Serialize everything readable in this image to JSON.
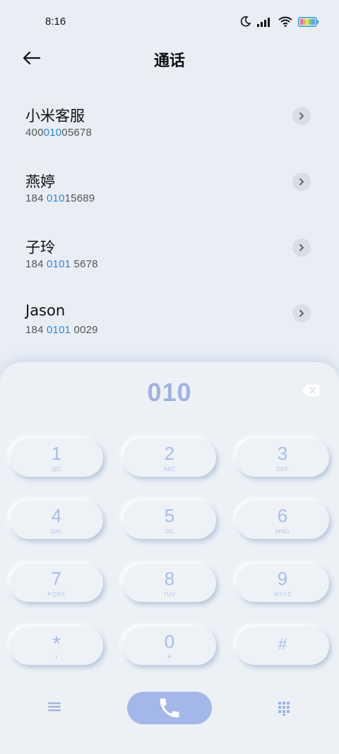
{
  "status_bar": {
    "time": "8:16",
    "icons": [
      "moon-icon",
      "signal-icon",
      "wifi-icon",
      "battery-icon"
    ]
  },
  "header": {
    "back_icon": "arrow-left-icon",
    "title": "通话"
  },
  "contacts": [
    {
      "name": "小米客服",
      "number_pre": "400",
      "number_match": "010",
      "number_post": "05678"
    },
    {
      "name": "燕婷",
      "number_pre": "184 ",
      "number_match": "010",
      "number_post": "15689"
    },
    {
      "name": "子玲",
      "number_pre": "184 ",
      "number_match": "0101",
      "number_post": " 5678"
    },
    {
      "name": "Jason",
      "number_pre": "184 ",
      "number_match": "0101",
      "number_post": " 0029"
    }
  ],
  "dialpad": {
    "display": "010",
    "keys": [
      {
        "digit": "1",
        "letters": "QO"
      },
      {
        "digit": "2",
        "letters": "ABC"
      },
      {
        "digit": "3",
        "letters": "DEF"
      },
      {
        "digit": "4",
        "letters": "GHI"
      },
      {
        "digit": "5",
        "letters": "JKL"
      },
      {
        "digit": "6",
        "letters": "MNO"
      },
      {
        "digit": "7",
        "letters": "PQRS"
      },
      {
        "digit": "8",
        "letters": "TUV"
      },
      {
        "digit": "9",
        "letters": "WXYZ"
      },
      {
        "digit": "*",
        "letters": ","
      },
      {
        "digit": "0",
        "letters": "+"
      },
      {
        "digit": "#",
        "letters": ""
      }
    ]
  },
  "colors": {
    "background": "#e9eef5",
    "accent": "#a3b8e8",
    "match_highlight": "#2b86d6",
    "key_text": "#a9bcea"
  }
}
